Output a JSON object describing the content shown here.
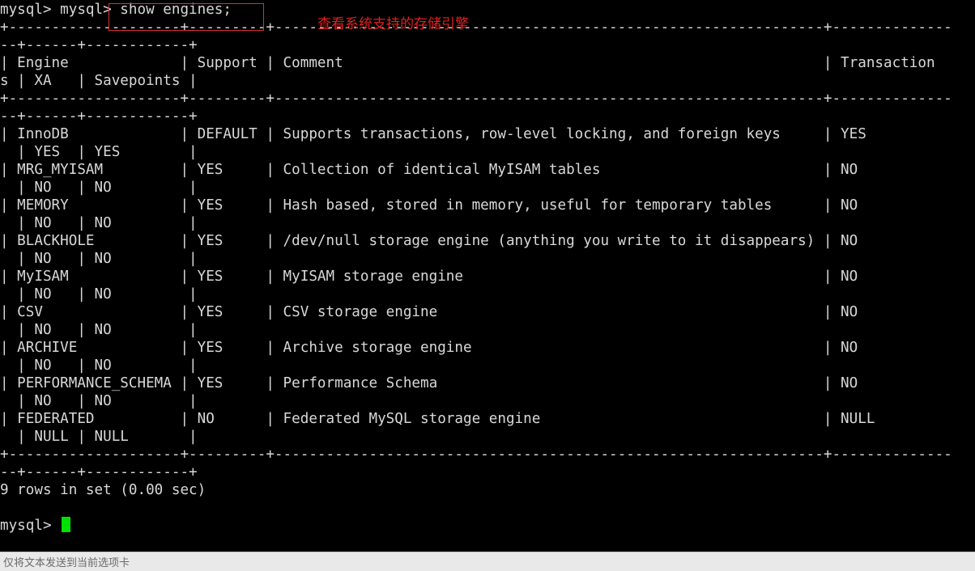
{
  "window": {
    "title": "mysql> show engines",
    "background_color": "#000000",
    "foreground_color": "#d8d8d8"
  },
  "terminal": {
    "prompt": "mysql>",
    "command": "show engines;",
    "cursor_color": "#00e000",
    "result_summary": "9 rows in set (0.00 sec)",
    "columns": [
      "Engine",
      "Support",
      "Comment",
      "Transactions",
      "XA",
      "Savepoints"
    ],
    "rows": [
      {
        "Engine": "InnoDB",
        "Support": "DEFAULT",
        "Comment": "Supports transactions, row-level locking, and foreign keys",
        "Transactions": "YES",
        "XA": "YES",
        "Savepoints": "YES"
      },
      {
        "Engine": "MRG_MYISAM",
        "Support": "YES",
        "Comment": "Collection of identical MyISAM tables",
        "Transactions": "NO",
        "XA": "NO",
        "Savepoints": "NO"
      },
      {
        "Engine": "MEMORY",
        "Support": "YES",
        "Comment": "Hash based, stored in memory, useful for temporary tables",
        "Transactions": "NO",
        "XA": "NO",
        "Savepoints": "NO"
      },
      {
        "Engine": "BLACKHOLE",
        "Support": "YES",
        "Comment": "/dev/null storage engine (anything you write to it disappears)",
        "Transactions": "NO",
        "XA": "NO",
        "Savepoints": "NO"
      },
      {
        "Engine": "MyISAM",
        "Support": "YES",
        "Comment": "MyISAM storage engine",
        "Transactions": "NO",
        "XA": "NO",
        "Savepoints": "NO"
      },
      {
        "Engine": "CSV",
        "Support": "YES",
        "Comment": "CSV storage engine",
        "Transactions": "NO",
        "XA": "NO",
        "Savepoints": "NO"
      },
      {
        "Engine": "ARCHIVE",
        "Support": "YES",
        "Comment": "Archive storage engine",
        "Transactions": "NO",
        "XA": "NO",
        "Savepoints": "NO"
      },
      {
        "Engine": "PERFORMANCE_SCHEMA",
        "Support": "YES",
        "Comment": "Performance Schema",
        "Transactions": "NO",
        "XA": "NO",
        "Savepoints": "NO"
      },
      {
        "Engine": "FEDERATED",
        "Support": "NO",
        "Comment": "Federated MySQL storage engine",
        "Transactions": "NULL",
        "XA": "NULL",
        "Savepoints": "NULL"
      }
    ],
    "screen_lines": [
      "mysql> mysql> show engines;",
      "+--------------------+---------+----------------------------------------------------------------+--------------",
      "--+------+------------+",
      "| Engine             | Support | Comment                                                        | Transaction",
      "s | XA   | Savepoints |",
      "+--------------------+---------+----------------------------------------------------------------+--------------",
      "--+------+------------+",
      "| InnoDB             | DEFAULT | Supports transactions, row-level locking, and foreign keys     | YES",
      "  | YES  | YES        |",
      "| MRG_MYISAM         | YES     | Collection of identical MyISAM tables                          | NO",
      "  | NO   | NO         |",
      "| MEMORY             | YES     | Hash based, stored in memory, useful for temporary tables      | NO",
      "  | NO   | NO         |",
      "| BLACKHOLE          | YES     | /dev/null storage engine (anything you write to it disappears) | NO",
      "  | NO   | NO         |",
      "| MyISAM             | YES     | MyISAM storage engine                                          | NO",
      "  | NO   | NO         |",
      "| CSV                | YES     | CSV storage engine                                             | NO",
      "  | NO   | NO         |",
      "| ARCHIVE            | YES     | Archive storage engine                                         | NO",
      "  | NO   | NO         |",
      "| PERFORMANCE_SCHEMA | YES     | Performance Schema                                             | NO",
      "  | NO   | NO         |",
      "| FEDERATED          | NO      | Federated MySQL storage engine                                 | NULL",
      "  | NULL | NULL       |",
      "+--------------------+---------+----------------------------------------------------------------+--------------",
      "--+------+------------+",
      "9 rows in set (0.00 sec)",
      "",
      "mysql> "
    ]
  },
  "annotations": {
    "box_label": "show engines command highlight",
    "note_text": "查看系统支持的存储引擎",
    "color": "#e02020"
  },
  "statusbar": {
    "text": "仅将文本发送到当前选项卡",
    "background_color": "#e9e9e9",
    "text_color": "#6a6a6a"
  }
}
